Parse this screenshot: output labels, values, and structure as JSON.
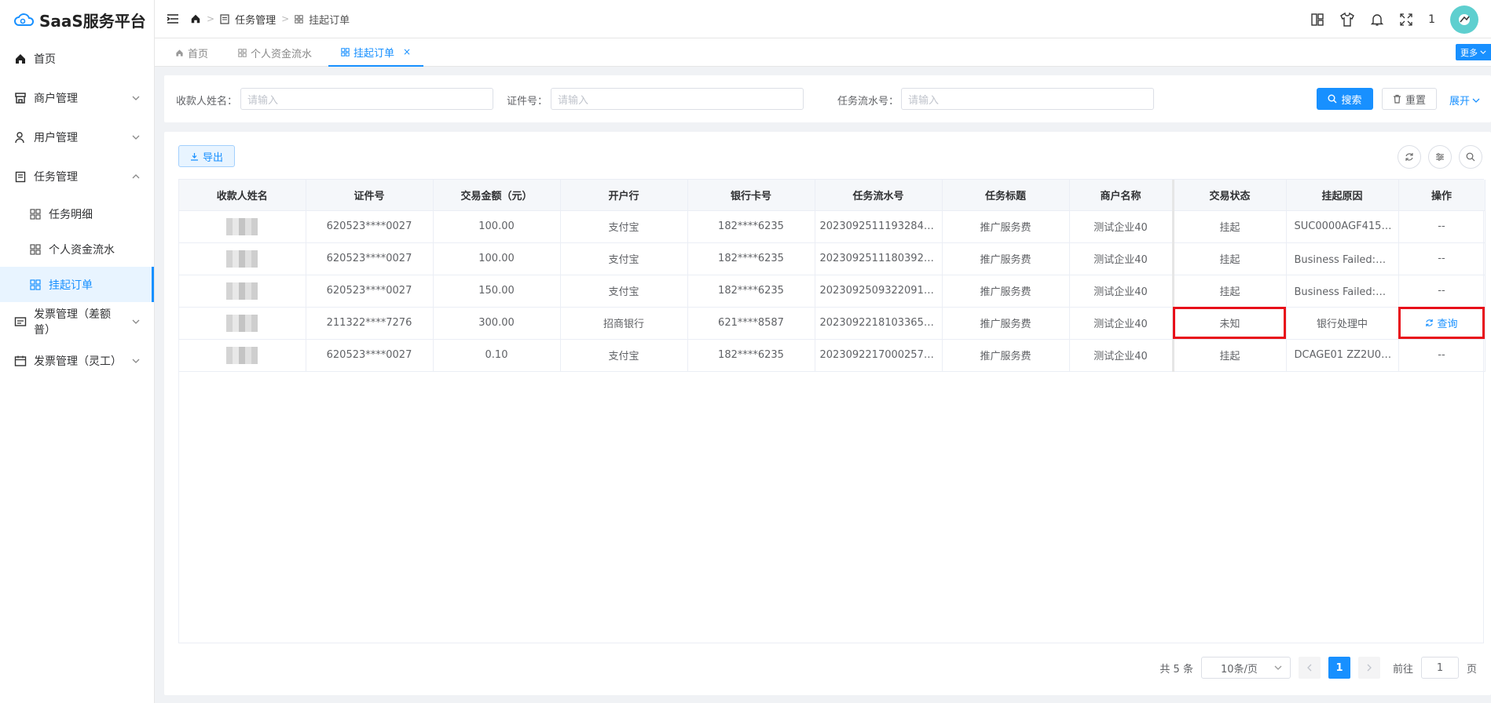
{
  "app": {
    "title": "SaaS服务平台"
  },
  "sidebar": {
    "items": [
      {
        "label": "首页"
      },
      {
        "label": "商户管理"
      },
      {
        "label": "用户管理"
      },
      {
        "label": "任务管理"
      },
      {
        "label": "任务明细"
      },
      {
        "label": "个人资金流水"
      },
      {
        "label": "挂起订单"
      },
      {
        "label": "发票管理（差额普）"
      },
      {
        "label": "发票管理（灵工）"
      }
    ]
  },
  "header": {
    "breadcrumb": [
      "任务管理",
      "挂起订单"
    ],
    "notification_count": "1"
  },
  "tabs": [
    {
      "label": "首页"
    },
    {
      "label": "个人资金流水"
    },
    {
      "label": "挂起订单",
      "close": "×"
    }
  ],
  "more_label": "更多",
  "search": {
    "payee_label": "收款人姓名：",
    "id_label": "证件号：",
    "serial_label": "任务流水号：",
    "placeholder": "请输入",
    "search_btn": "搜索",
    "reset_btn": "重置",
    "expand": "展开"
  },
  "toolbar": {
    "export": "导出"
  },
  "table": {
    "columns": [
      "收款人姓名",
      "证件号",
      "交易金额（元）",
      "开户行",
      "银行卡号",
      "任务流水号",
      "任务标题",
      "商户名称",
      "交易状态",
      "挂起原因",
      "操作"
    ],
    "rows": [
      {
        "id_no": "620523****0027",
        "amount": "100.00",
        "bank": "支付宝",
        "card": "182****6235",
        "serial": "20230925111932840...",
        "task": "推广服务费",
        "merchant": "测试企业40",
        "status": "挂起",
        "reason": "SUC0000AGF415Y...",
        "op": "--"
      },
      {
        "id_no": "620523****0027",
        "amount": "100.00",
        "bank": "支付宝",
        "card": "182****6235",
        "serial": "20230925111803920...",
        "task": "推广服务费",
        "merchant": "测试企业40",
        "status": "挂起",
        "reason": "Business Failed:余...",
        "op": "--"
      },
      {
        "id_no": "620523****0027",
        "amount": "150.00",
        "bank": "支付宝",
        "card": "182****6235",
        "serial": "20230925093220914...",
        "task": "推广服务费",
        "merchant": "测试企业40",
        "status": "挂起",
        "reason": "Business Failed:余...",
        "op": "--"
      },
      {
        "id_no": "211322****7276",
        "amount": "300.00",
        "bank": "招商银行",
        "card": "621****8587",
        "serial": "20230922181033652...",
        "task": "推广服务费",
        "merchant": "测试企业40",
        "status": "未知",
        "reason": "银行处理中",
        "op": "查询"
      },
      {
        "id_no": "620523****0027",
        "amount": "0.10",
        "bank": "支付宝",
        "card": "182****6235",
        "serial": "20230922170002571...",
        "task": "推广服务费",
        "merchant": "测试企业40",
        "status": "挂起",
        "reason": "DCAGE01 ZZ2U01...",
        "op": "--"
      }
    ]
  },
  "pagination": {
    "total": "共 5 条",
    "page_size": "10条/页",
    "current": "1",
    "goto_label": "前往",
    "goto_value": "1",
    "page_suffix": "页"
  },
  "colors": {
    "accent": "#1890ff",
    "highlight": "#e8101a"
  }
}
